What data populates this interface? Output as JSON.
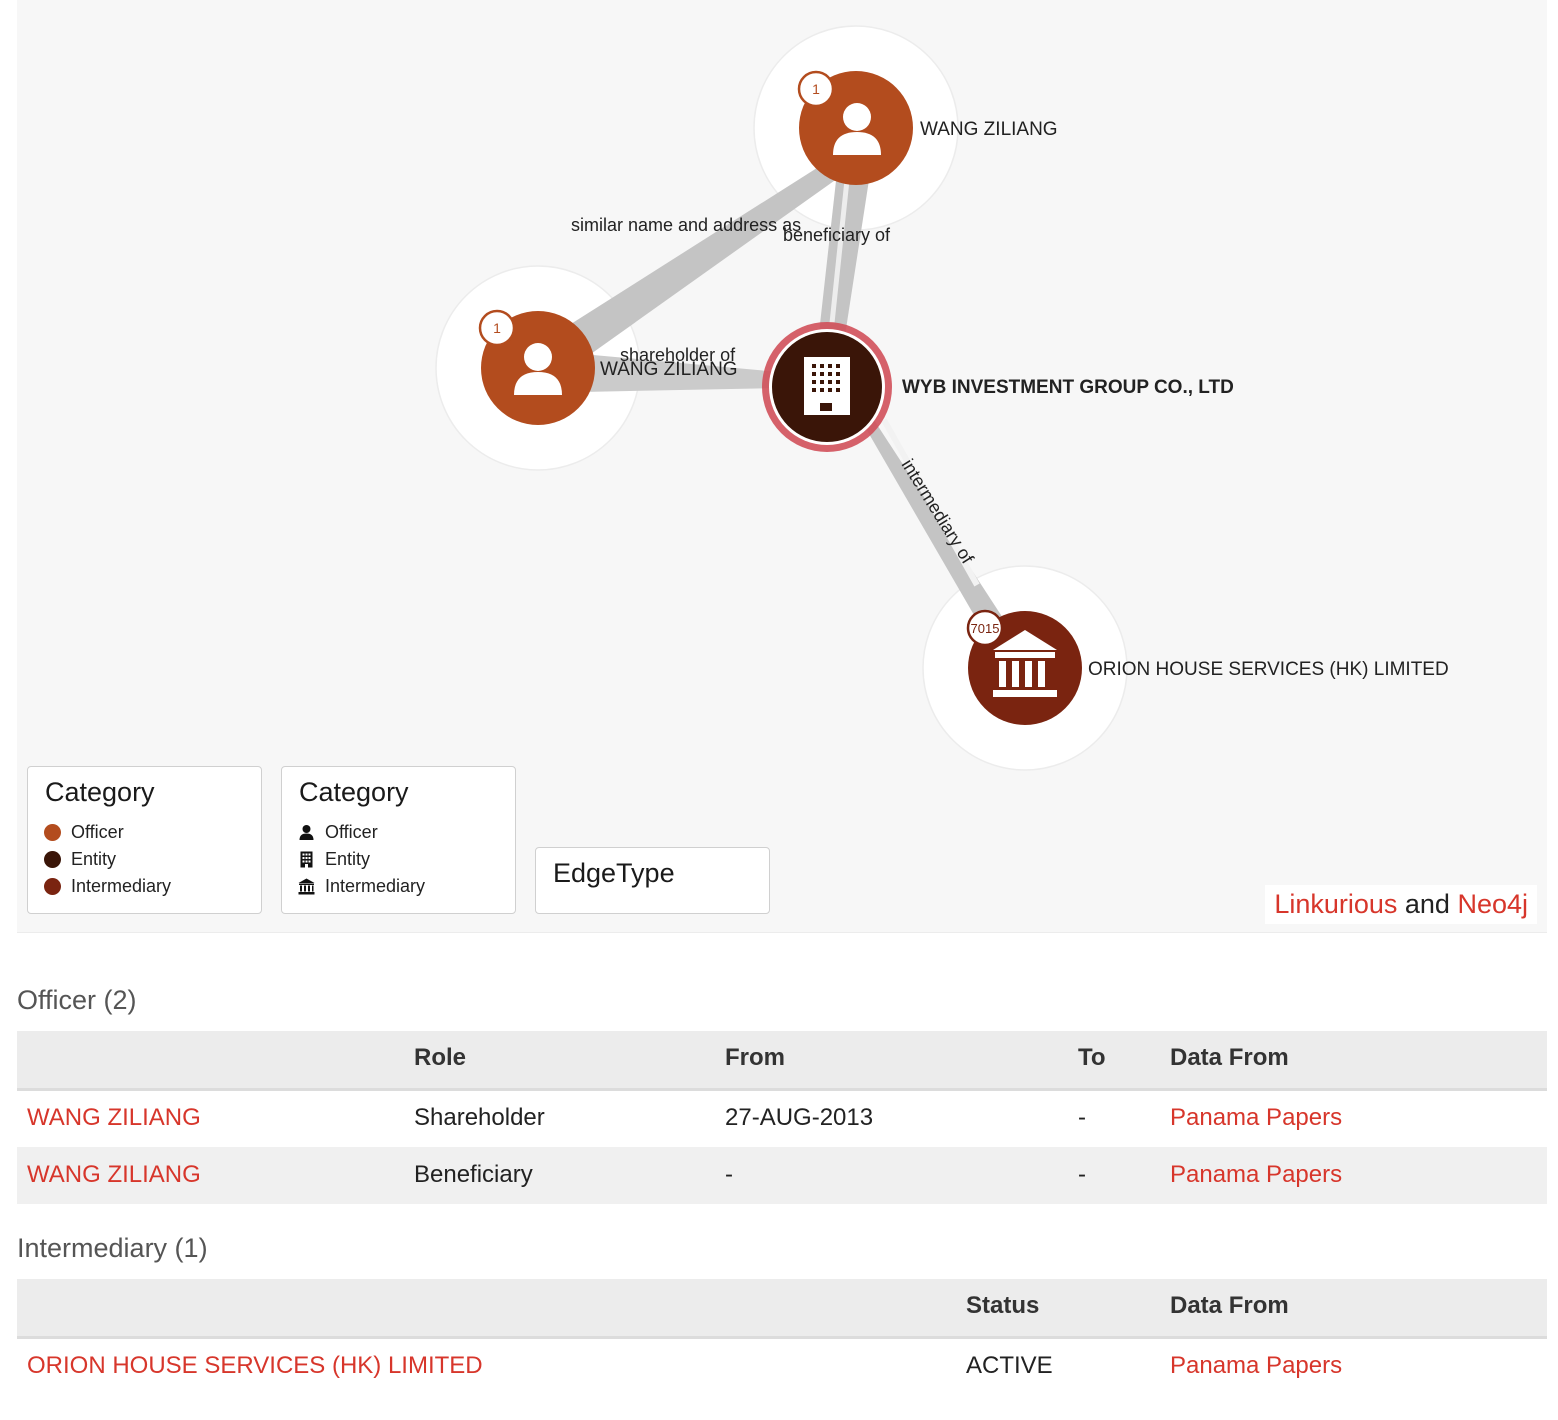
{
  "graph": {
    "nodes": [
      {
        "id": "officer-top",
        "label": "WANG ZILIANG",
        "badge": "1",
        "kind": "officer",
        "color": "#b34c1e"
      },
      {
        "id": "officer-left",
        "label": "WANG ZILIANG",
        "badge": "1",
        "kind": "officer",
        "color": "#b34c1e"
      },
      {
        "id": "entity",
        "label": "WYB INVESTMENT GROUP CO., LTD",
        "badge": "",
        "kind": "entity",
        "color": "#3a1508"
      },
      {
        "id": "intermediary",
        "label": "ORION HOUSE SERVICES (HK) LIMITED",
        "badge": "7015",
        "kind": "intermediary",
        "color": "#7a2410"
      }
    ],
    "edges": [
      {
        "from": "officer-left",
        "to": "officer-top",
        "label": "similar name and address as"
      },
      {
        "from": "officer-top",
        "to": "entity",
        "label": "beneficiary of"
      },
      {
        "from": "officer-left",
        "to": "entity",
        "label": "shareholder of"
      },
      {
        "from": "entity",
        "to": "intermediary",
        "label": "intermediary of"
      }
    ]
  },
  "legend_color": {
    "title": "Category",
    "items": [
      {
        "label": "Officer",
        "color": "#b34c1e"
      },
      {
        "label": "Entity",
        "color": "#3a1508"
      },
      {
        "label": "Intermediary",
        "color": "#7a2410"
      }
    ]
  },
  "legend_icon": {
    "title": "Category",
    "items": [
      {
        "label": "Officer",
        "icon": "person-icon"
      },
      {
        "label": "Entity",
        "icon": "building-icon"
      },
      {
        "label": "Intermediary",
        "icon": "bank-icon"
      }
    ]
  },
  "legend_edge": {
    "title": "EdgeType"
  },
  "credit": {
    "part1": "Linkurious",
    "mid": " and ",
    "part2": "Neo4j"
  },
  "officer_section": {
    "title": "Officer (2)",
    "headers": [
      "",
      "Role",
      "From",
      "To",
      "Data From"
    ],
    "rows": [
      {
        "name": "WANG ZILIANG",
        "role": "Shareholder",
        "from": "27-AUG-2013",
        "to": "-",
        "source": "Panama Papers"
      },
      {
        "name": "WANG ZILIANG",
        "role": "Beneficiary",
        "from": "-",
        "to": "-",
        "source": "Panama Papers"
      }
    ]
  },
  "intermediary_section": {
    "title": "Intermediary (1)",
    "headers": [
      "",
      "Status",
      "Data From"
    ],
    "rows": [
      {
        "name": "ORION HOUSE SERVICES (HK) LIMITED",
        "status": "ACTIVE",
        "source": "Panama Papers"
      }
    ]
  },
  "colors": {
    "link": "#d7362b",
    "entity_ring": "#d0505a"
  }
}
